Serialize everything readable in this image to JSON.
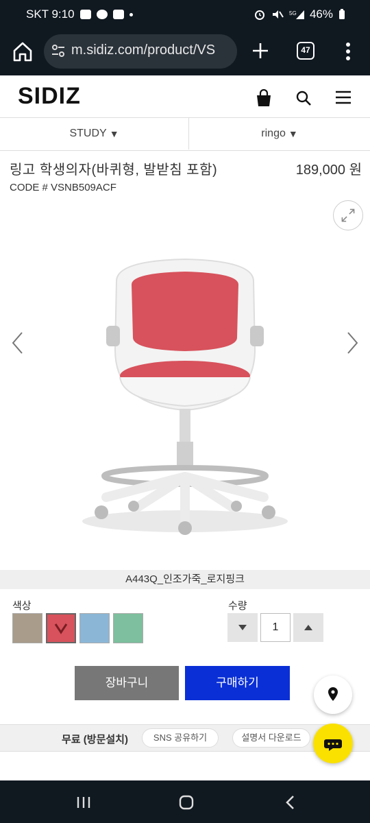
{
  "status_bar": {
    "carrier_time": "SKT 9:10",
    "battery": "46%"
  },
  "browser": {
    "url": "m.sidiz.com/product/VS",
    "tab_count": "47"
  },
  "site": {
    "logo": "SIDIZ"
  },
  "category": {
    "left": "STUDY",
    "right": "ringo"
  },
  "product": {
    "name": "링고 학생의자(바퀴형, 발받침 포함)",
    "price": "189,000 원",
    "code": "CODE # VSNB509ACF",
    "selected_color_label": "A443Q_인조가죽_로지핑크"
  },
  "options": {
    "color_label": "색상",
    "qty_label": "수량",
    "qty_value": "1",
    "swatch_colors": [
      "#a99c8a",
      "#d7525c",
      "#8cb6d6",
      "#7dbf9e"
    ],
    "selected_swatch_index": 1
  },
  "actions": {
    "cart": "장바구니",
    "buy": "구매하기"
  },
  "bottom": {
    "free_install": "무료 (방문설치)",
    "sns_share": "SNS 공유하기",
    "manual_download": "설명서 다운로드"
  },
  "colors": {
    "brand_blue": "#0a2fd6",
    "chat_yellow": "#fae100",
    "chair_pink": "#d7525c"
  }
}
